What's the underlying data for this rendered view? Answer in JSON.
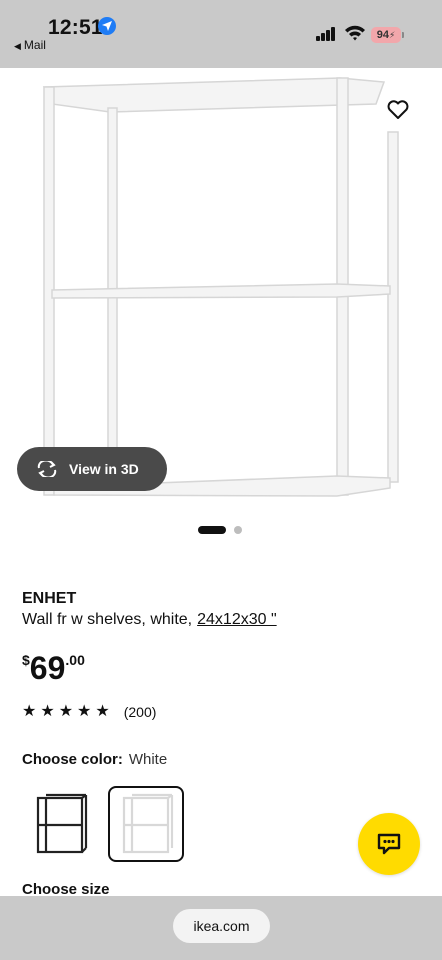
{
  "status_bar": {
    "time": "12:51",
    "back_label": "Mail",
    "battery": "94",
    "icons": [
      "location-icon",
      "cellular-signal-icon",
      "wifi-icon",
      "battery-icon"
    ]
  },
  "product": {
    "brand": "ENHET",
    "description": "Wall fr w shelves, white,",
    "size_link": "24x12x30 \"",
    "price": {
      "currency": "$",
      "integer": "69",
      "decimal": ".00"
    },
    "rating": {
      "stars": 5,
      "count": "(200)"
    }
  },
  "gallery": {
    "view_3d_label": "View in 3D",
    "current_image": 1,
    "total_images": 2
  },
  "color": {
    "label": "Choose color:",
    "selected": "White",
    "options": [
      "black",
      "white"
    ]
  },
  "size_section": {
    "label": "Choose size"
  },
  "browser": {
    "url": "ikea.com"
  },
  "colors": {
    "chat_button": "#ffdb00",
    "status_bar_bg": "#c9c9c9",
    "location_blue": "#1f7cf5"
  }
}
